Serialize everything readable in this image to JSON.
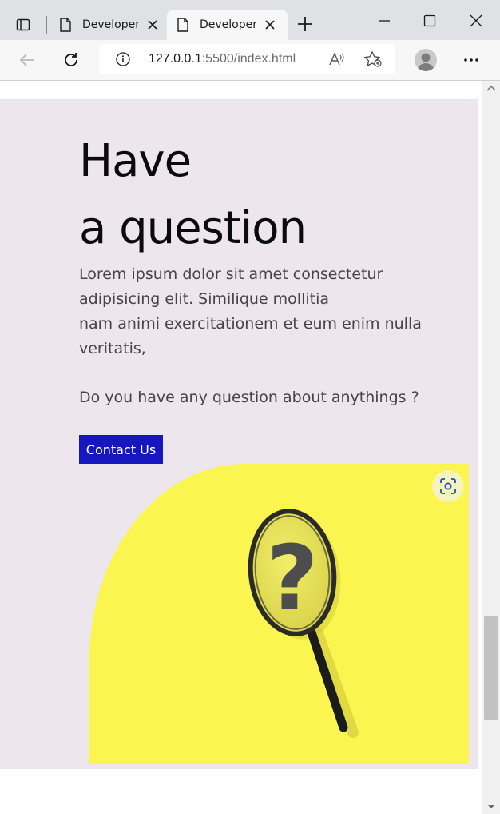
{
  "browser": {
    "tabs": [
      {
        "title": "Developer",
        "active": false
      },
      {
        "title": "Developer",
        "active": true
      }
    ],
    "address": {
      "host": "127.0.0.1",
      "path": ":5500/index.html"
    }
  },
  "page": {
    "heading_line1": "Have",
    "heading_line2": "a question",
    "paragraph_lines": [
      "Lorem ipsum dolor sit amet consectetur",
      "adipisicing elit. Similique mollitia",
      "nam animi exercitationem et eum enim nulla",
      "veritatis,"
    ],
    "question": "Do you have any question about anythings ?",
    "cta_label": "Contact Us",
    "image_glyph": "?"
  },
  "colors": {
    "section_bg": "#ede6ec",
    "cta_bg": "#1717bf",
    "image_bg": "#fbf64f"
  },
  "icons": [
    "tab-actions-icon",
    "page-icon",
    "close-icon",
    "new-tab-icon",
    "minimize-icon",
    "maximize-icon",
    "window-close-icon",
    "back-icon",
    "refresh-icon",
    "info-icon",
    "read-aloud-icon",
    "favorites-icon",
    "profile-icon",
    "more-icon",
    "visual-search-icon"
  ]
}
